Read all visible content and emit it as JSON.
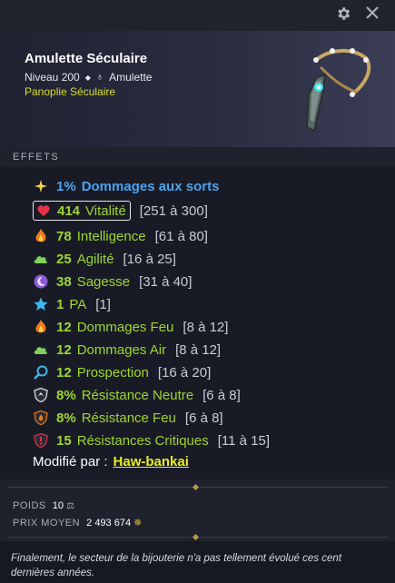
{
  "toolbar": {
    "settings_icon": "gear-icon",
    "close_icon": "close-icon"
  },
  "item": {
    "name": "Amulette Séculaire",
    "level": "Niveau 200",
    "type": "Amulette",
    "set": "Panoplie Séculaire",
    "image": "amulet-icon"
  },
  "effects_header": "EFFETS",
  "effects": [
    {
      "icon": "sparkle-icon",
      "value": "1%",
      "name": "Dommages aux sorts",
      "range": "",
      "color": "#4aa3f0"
    },
    {
      "icon": "heart-icon",
      "value": "414",
      "name": "Vitalité",
      "range": "[251 à 300]",
      "color": "#9fd631",
      "boxed": true
    },
    {
      "icon": "fire-icon",
      "value": "78",
      "name": "Intelligence",
      "range": "[61 à 80]",
      "color": "#9fd631"
    },
    {
      "icon": "cloud-icon",
      "value": "25",
      "name": "Agilité",
      "range": "[16 à 25]",
      "color": "#9fd631"
    },
    {
      "icon": "moon-icon",
      "value": "38",
      "name": "Sagesse",
      "range": "[31 à 40]",
      "color": "#9fd631"
    },
    {
      "icon": "star-icon",
      "value": "1",
      "name": "PA",
      "range": "[1]",
      "color": "#9fd631"
    },
    {
      "icon": "fire-icon",
      "value": "12",
      "name": "Dommages Feu",
      "range": "[8 à 12]",
      "color": "#9fd631"
    },
    {
      "icon": "cloud-icon",
      "value": "12",
      "name": "Dommages Air",
      "range": "[8 à 12]",
      "color": "#9fd631"
    },
    {
      "icon": "magnifier-icon",
      "value": "12",
      "name": "Prospection",
      "range": "[16 à 20]",
      "color": "#9fd631"
    },
    {
      "icon": "shield-neutral-icon",
      "value": "8%",
      "name": "Résistance Neutre",
      "range": "[6 à 8]",
      "color": "#9fd631"
    },
    {
      "icon": "shield-fire-icon",
      "value": "8%",
      "name": "Résistance Feu",
      "range": "[6 à 8]",
      "color": "#9fd631"
    },
    {
      "icon": "shield-critical-icon",
      "value": "15",
      "name": "Résistances Critiques",
      "range": "[11 à 15]",
      "color": "#9fd631"
    }
  ],
  "modified": {
    "label": "Modifié par :",
    "by": "Haw-bankai"
  },
  "weight": {
    "label": "POIDS",
    "value": "10"
  },
  "avg_price": {
    "label": "PRIX MOYEN",
    "value": "2 493 674"
  },
  "description": "Finalement, le secteur de la bijouterie n'a pas tellement évolué ces cent dernières années."
}
